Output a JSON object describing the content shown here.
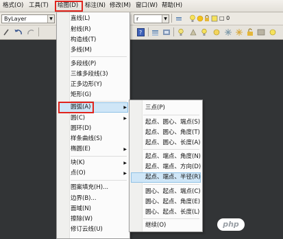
{
  "menubar": {
    "items": [
      "格式(O)",
      "工具(T)",
      "绘图(D)",
      "标注(N)",
      "修改(M)",
      "窗口(W)",
      "帮助(H)"
    ],
    "layer_state": "□ 0"
  },
  "toolbar": {
    "linetype_value": "ByLayer",
    "combo2_value": "r"
  },
  "draw_menu": {
    "items": [
      "直线(L)",
      "射线(R)",
      "构造线(T)",
      "多线(M)",
      "多段线(P)",
      "三维多段线(3)",
      "正多边形(Y)",
      "矩形(G)",
      "圆弧(A)",
      "圆(C)",
      "圆环(D)",
      "样条曲线(S)",
      "椭圆(E)",
      "块(K)",
      "点(O)",
      "图案填充(H)...",
      "边界(B)...",
      "面域(N)",
      "擦除(W)",
      "修订云线(U)"
    ]
  },
  "arc_menu": {
    "items": [
      "三点(P)",
      "起点、圆心、端点(S)",
      "起点、圆心、角度(T)",
      "起点、圆心、长度(A)",
      "起点、端点、角度(N)",
      "起点、端点、方向(D)",
      "起点、端点、半径(R)",
      "圆心、起点、端点(C)",
      "圆心、起点、角度(E)",
      "圆心、起点、长度(L)",
      "继续(O)"
    ]
  },
  "watermark": "php",
  "colors": {
    "highlight_border": "#e0231c",
    "hover_bg": "#cfe6f7",
    "canvas": "#323436"
  }
}
